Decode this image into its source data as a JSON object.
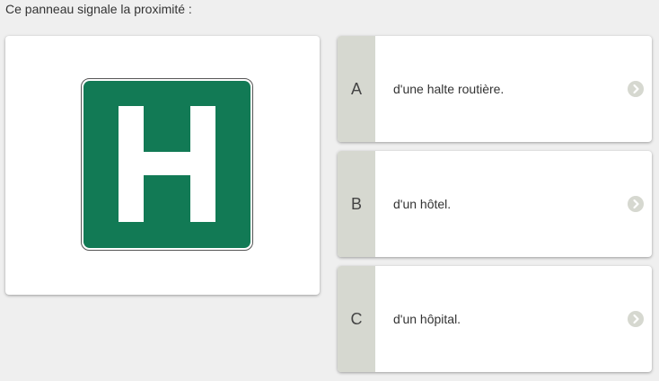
{
  "question": {
    "text": "Ce panneau signale la proximité :"
  },
  "sign": {
    "letter": "H",
    "background_color": "#127a55",
    "foreground_color": "#ffffff"
  },
  "answers": [
    {
      "letter": "A",
      "text": "d'une halte routière.",
      "icon": "chevron-right-circle-icon"
    },
    {
      "letter": "B",
      "text": "d'un hôtel.",
      "icon": "chevron-right-circle-icon"
    },
    {
      "letter": "C",
      "text": "d'un hôpital.",
      "icon": "chevron-right-circle-icon"
    }
  ]
}
